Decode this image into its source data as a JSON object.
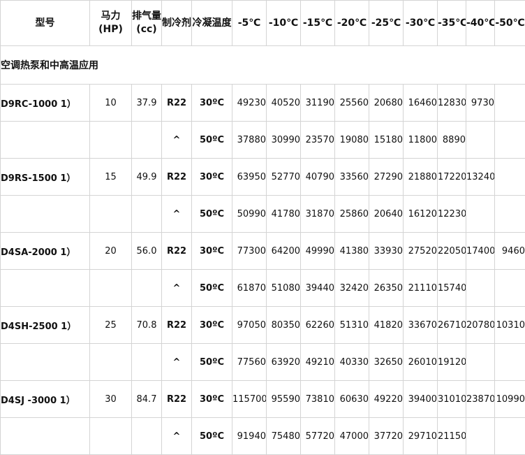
{
  "headers": {
    "model": "型号",
    "hp": "马力(HP)",
    "displacement": "排气量(cc)",
    "refrigerant": "制冷剂",
    "condensing": "冷凝温度",
    "temps": [
      "-5℃",
      "-10℃",
      "-15℃",
      "-20℃",
      "-25℃",
      "-30℃",
      "-35℃",
      "-40℃",
      "-50℃"
    ]
  },
  "section_title": "空调热泵和中高温应用",
  "rows": [
    {
      "model": "D9RC-1000 1）",
      "hp": "10",
      "disp": "37.9",
      "ref": "R22",
      "cond": "30ºC",
      "values": [
        "49230",
        "40520",
        "31190",
        "25560",
        "20680",
        "16460",
        "12830",
        "9730",
        ""
      ]
    },
    {
      "model": "",
      "hp": "",
      "disp": "",
      "ref": "^",
      "cond": "50ºC",
      "values": [
        "37880",
        "30990",
        "23570",
        "19080",
        "15180",
        "11800",
        "8890",
        "",
        ""
      ]
    },
    {
      "model": "D9RS-1500 1）",
      "hp": "15",
      "disp": "49.9",
      "ref": "R22",
      "cond": "30ºC",
      "values": [
        "63950",
        "52770",
        "40790",
        "33560",
        "27290",
        "21880",
        "17220",
        "13240",
        ""
      ]
    },
    {
      "model": "",
      "hp": "",
      "disp": "",
      "ref": "^",
      "cond": "50ºC",
      "values": [
        "50990",
        "41780",
        "31870",
        "25860",
        "20640",
        "16120",
        "12230",
        "",
        ""
      ]
    },
    {
      "model": "D4SA-2000 1）",
      "hp": "20",
      "disp": "56.0",
      "ref": "R22",
      "cond": "30ºC",
      "values": [
        "77300",
        "64200",
        "49990",
        "41380",
        "33930",
        "27520",
        "22050",
        "17400",
        "9460"
      ]
    },
    {
      "model": "",
      "hp": "",
      "disp": "",
      "ref": "^",
      "cond": "50ºC",
      "values": [
        "61870",
        "51080",
        "39440",
        "32420",
        "26350",
        "21110",
        "15740",
        "",
        ""
      ]
    },
    {
      "model": "D4SH-2500 1）",
      "hp": "25",
      "disp": "70.8",
      "ref": "R22",
      "cond": "30ºC",
      "values": [
        "97050",
        "80350",
        "62260",
        "51310",
        "41820",
        "33670",
        "26710",
        "20780",
        "10310"
      ]
    },
    {
      "model": "",
      "hp": "",
      "disp": "",
      "ref": "^",
      "cond": "50ºC",
      "values": [
        "77560",
        "63920",
        "49210",
        "40330",
        "32650",
        "26010",
        "19120",
        "",
        ""
      ]
    },
    {
      "model": "D4SJ -3000 1）",
      "hp": "30",
      "disp": "84.7",
      "ref": "R22",
      "cond": "30ºC",
      "values": [
        "115700",
        "95590",
        "73810",
        "60630",
        "49220",
        "39400",
        "31010",
        "23870",
        "10990"
      ]
    },
    {
      "model": "",
      "hp": "",
      "disp": "",
      "ref": "^",
      "cond": "50ºC",
      "values": [
        "91940",
        "75480",
        "57720",
        "47000",
        "37720",
        "29710",
        "21150",
        "",
        ""
      ]
    }
  ]
}
